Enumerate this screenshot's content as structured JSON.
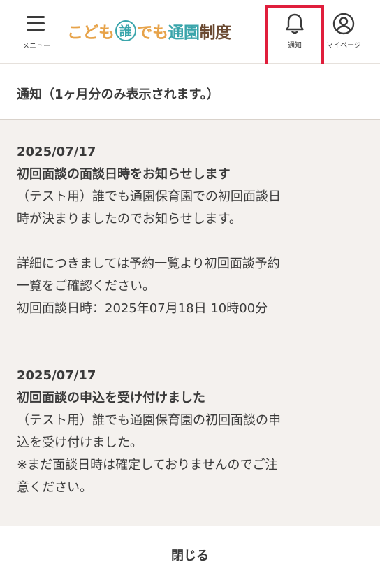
{
  "header": {
    "menu_label": "メニュー",
    "logo": {
      "part1": "こども",
      "badge": "誰",
      "part2": "でも",
      "part3": "通園",
      "part4": "制度"
    },
    "notification_label": "通知",
    "mypage_label": "マイページ"
  },
  "panel": {
    "title": "通知（1ヶ月分のみ表示されます。）",
    "notifications": [
      {
        "date": "2025/07/17",
        "title": "初回面談の面談日時をお知らせします",
        "body": "（テスト用）誰でも通園保育園での初回面談日\n時が決まりましたのでお知らせします。\n\n詳細につきましては予約一覧より初回面談予約\n一覧をご確認ください。\n初回面談日時：2025年07月18日 10時00分"
      },
      {
        "date": "2025/07/17",
        "title": "初回面談の申込を受け付けました",
        "body": "（テスト用）誰でも通園保育園の初回面談の申\n込を受け付けました。\n※まだ面談日時は確定しておりませんのでご注\n意ください。"
      }
    ],
    "close_label": "閉じる"
  },
  "colors": {
    "logo_orange": "#e7a34a",
    "logo_teal": "#3aa5ab",
    "logo_brown": "#6b4a32",
    "highlight": "#e01e3c",
    "list_background": "#f4f1ee"
  }
}
